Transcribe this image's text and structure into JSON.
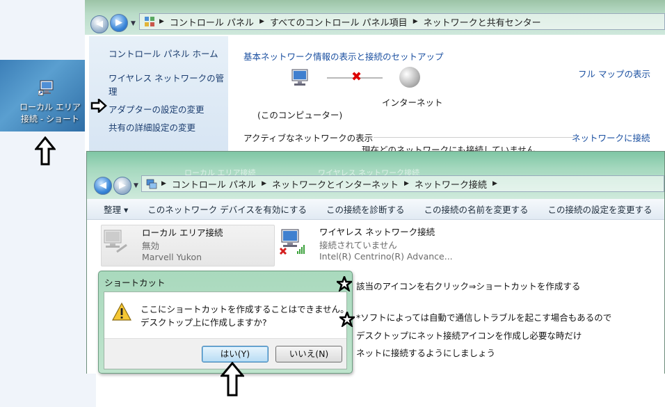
{
  "desktop": {
    "shortcut_label_line1": "ローカル エリア",
    "shortcut_label_line2": "接続 - ショート"
  },
  "network_center": {
    "breadcrumb": [
      "コントロール パネル",
      "すべてのコントロール パネル項目",
      "ネットワークと共有センター"
    ],
    "sidebar": [
      "コントロール パネル ホーム",
      "ワイヤレス ネットワークの管",
      "理",
      "アダプターの設定の変更",
      "共有の詳細設定の変更"
    ],
    "heading": "基本ネットワーク情報の表示と接続のセットアップ",
    "full_map": "フル マップの表示",
    "internet_label": "インターネット",
    "computer_label": "(このコンピューター)",
    "active_networks": "アクティブなネットワークの表示",
    "connect_link": "ネットワークに接続",
    "not_connected": "現在どのネットワークにも接続していません"
  },
  "connections_window": {
    "ghost_tabs": [
      "ローカル エリア接続",
      "ワイヤレス ネットワーク接続"
    ],
    "breadcrumb": [
      "コントロール パネル",
      "ネットワークとインターネット",
      "ネットワーク接続"
    ],
    "toolbar": [
      "整理 ▾",
      "このネットワーク デバイスを有効にする",
      "この接続を診断する",
      "この接続の名前を変更する",
      "この接続の設定を変更する"
    ],
    "items": [
      {
        "name": "ローカル エリア接続",
        "status": "無効",
        "device": "Marvell Yukon"
      },
      {
        "name": "ワイヤレス ネットワーク接続",
        "status": "接続されていません",
        "device": "Intel(R) Centrino(R) Advance..."
      }
    ]
  },
  "dialog": {
    "title": "ショートカット",
    "message_line1": "ここにショートカットを作成することはできません。",
    "message_line2": "デスクトップ上に作成しますか?",
    "yes_label": "はい(Y)",
    "no_label": "いいえ(N)"
  },
  "annotations": {
    "note1": "該当のアイコンを右クリック⇒ショートカットを作成する",
    "note2_line1": "*ソフトによっては自動で通信しトラブルを起こす場合もあるので",
    "note2_line2": "デスクトップにネット接続アイコンを作成し必要な時だけ",
    "note2_line3": "ネットに接続するようにしましょう"
  }
}
